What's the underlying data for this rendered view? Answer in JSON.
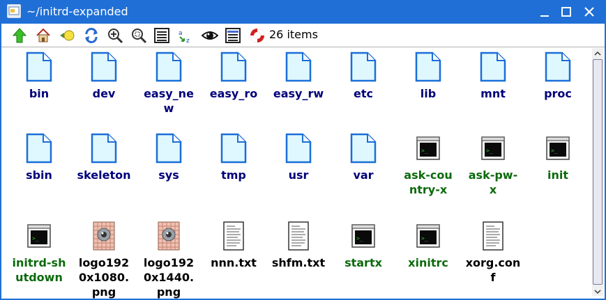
{
  "window": {
    "title": "~/initrd-expanded",
    "controls": [
      {
        "name": "minimize-button",
        "icon": "minimize-icon"
      },
      {
        "name": "maximize-button",
        "icon": "maximize-icon"
      },
      {
        "name": "close-button",
        "icon": "close-icon"
      }
    ]
  },
  "toolbar": {
    "buttons": [
      {
        "name": "go-up-button",
        "icon": "up-arrow-icon"
      },
      {
        "name": "home-button",
        "icon": "home-icon"
      },
      {
        "name": "bookmark-button",
        "icon": "bulb-icon"
      },
      {
        "name": "refresh-button",
        "icon": "refresh-icon"
      },
      {
        "name": "zoom-in-button",
        "icon": "zoom-in-icon"
      },
      {
        "name": "zoom-fit-button",
        "icon": "zoom-fit-icon"
      },
      {
        "name": "list-view-button",
        "icon": "list-icon"
      },
      {
        "name": "sort-button",
        "icon": "sort-az-icon"
      },
      {
        "name": "show-hidden-button",
        "icon": "eye-icon"
      },
      {
        "name": "details-view-button",
        "icon": "details-icon"
      },
      {
        "name": "help-button",
        "icon": "lifebuoy-icon"
      }
    ],
    "item_count": "26 items"
  },
  "files": [
    {
      "label": "bin",
      "type": "dir"
    },
    {
      "label": "dev",
      "type": "dir"
    },
    {
      "label": "easy_new",
      "type": "dir"
    },
    {
      "label": "easy_ro",
      "type": "dir"
    },
    {
      "label": "easy_rw",
      "type": "dir"
    },
    {
      "label": "etc",
      "type": "dir"
    },
    {
      "label": "lib",
      "type": "dir"
    },
    {
      "label": "mnt",
      "type": "dir"
    },
    {
      "label": "proc",
      "type": "dir"
    },
    {
      "label": "sbin",
      "type": "dir"
    },
    {
      "label": "skeleton",
      "type": "dir"
    },
    {
      "label": "sys",
      "type": "dir"
    },
    {
      "label": "tmp",
      "type": "dir"
    },
    {
      "label": "usr",
      "type": "dir"
    },
    {
      "label": "var",
      "type": "dir"
    },
    {
      "label": "ask-country-x",
      "type": "exe"
    },
    {
      "label": "ask-pw-x",
      "type": "exe"
    },
    {
      "label": "init",
      "type": "exe"
    },
    {
      "label": "initrd-shutdown",
      "type": "exe"
    },
    {
      "label": "logo1920x1080.png",
      "type": "image"
    },
    {
      "label": "logo1920x1440.png",
      "type": "image"
    },
    {
      "label": "nnn.txt",
      "type": "text"
    },
    {
      "label": "shfm.txt",
      "type": "text"
    },
    {
      "label": "startx",
      "type": "exe"
    },
    {
      "label": "xinitrc",
      "type": "exe"
    },
    {
      "label": "xorg.conf",
      "type": "text"
    }
  ],
  "colors": {
    "titlebar": "#1f6fd6",
    "dir_label": "#00007a",
    "exe_label": "#0c6a0c",
    "file_label": "#000000"
  }
}
